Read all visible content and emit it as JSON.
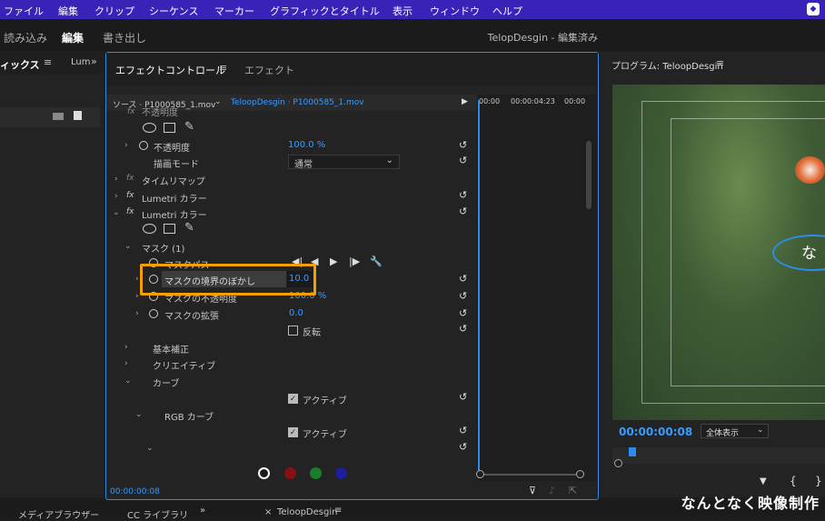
{
  "menu": [
    "ファイル",
    "編集",
    "クリップ",
    "シーケンス",
    "マーカー",
    "グラフィックとタイトル",
    "表示",
    "ウィンドウ",
    "ヘルプ"
  ],
  "workspaces": {
    "import": "読み込み",
    "edit": "編集",
    "export": "書き出し"
  },
  "project_title": "TelopDesgin - 編集済み",
  "left_panel": {
    "tab1": "ィックス",
    "tab2": "Lum",
    "more": "»"
  },
  "effect_controls": {
    "tab_active": "エフェクトコントロール",
    "tab_inactive": "エフェクト",
    "source_label": "ソース · P1000585_1.mov",
    "sequence_label": "TeloopDesgin · P1000585_1.mov",
    "tl_time_start": "00:00",
    "tl_time_mid": "00:00:04:23",
    "tl_time_end": "00:00",
    "current_time": "00:00:00:08",
    "rows": {
      "opacity_header": "不透明度",
      "opacity": "不透明度",
      "opacity_value": "100.0 %",
      "blend_mode": "描画モード",
      "blend_value": "通常",
      "time_remap": "タイムリマップ",
      "lumetri1": "Lumetri カラー",
      "lumetri2": "Lumetri カラー",
      "mask": "マスク (1)",
      "mask_path": "マスクパス",
      "mask_feather": "マスクの境界のぼかし",
      "mask_feather_value": "10.0",
      "mask_opacity": "マスクの不透明度",
      "mask_opacity_value": "100.0 %",
      "mask_expansion": "マスクの拡張",
      "mask_expansion_value": "0.0",
      "invert": "反転",
      "basic": "基本補正",
      "creative": "クリエイティブ",
      "curves": "カーブ",
      "active1": "アクティブ",
      "rgb_curve": "RGB カーブ",
      "active2": "アクティブ"
    }
  },
  "program": {
    "title": "プログラム: TeloopDesgin",
    "timecode": "00:00:00:08",
    "zoom": "全体表示",
    "mask_text": "な"
  },
  "bottom_tabs": {
    "media": "メディアブラウザー",
    "cc": "CC ライブラリ",
    "timeline": "TeloopDesgin"
  },
  "watermark": "なんとなく映像制作",
  "colors": {
    "accent": "#2d8ceb",
    "highlight": "#f5a000",
    "menubar": "#3823b8"
  }
}
